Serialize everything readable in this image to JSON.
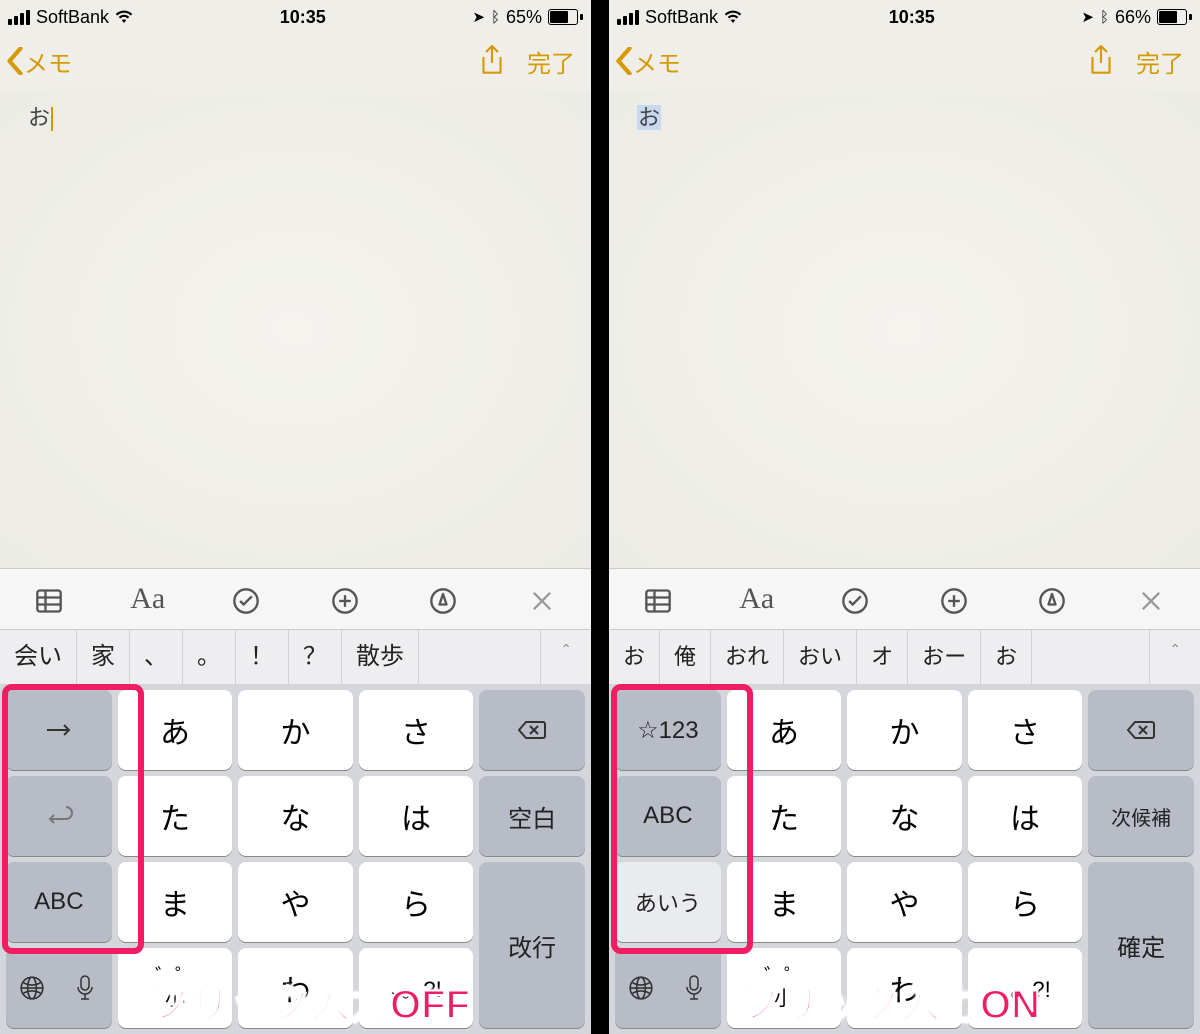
{
  "left": {
    "status": {
      "carrier": "SoftBank",
      "time": "10:35",
      "battery_pct": "65%",
      "battery_fill": 65
    },
    "nav": {
      "back_label": "メモ",
      "done_label": "完了"
    },
    "note_text": "お",
    "note_has_caret": true,
    "note_selected": false,
    "format_icons": [
      "grid-icon",
      "text-style-icon",
      "check-circle-icon",
      "plus-circle-icon",
      "pen-circle-icon",
      "close-icon"
    ],
    "suggestions": [
      "会い",
      "家",
      "、",
      "。",
      "！",
      "？",
      "散歩"
    ],
    "keyboard": {
      "side_keys": [
        "→",
        "↩",
        "ABC"
      ],
      "side_styles": [
        "func",
        "func",
        "func"
      ],
      "main": [
        [
          "あ",
          "か",
          "さ"
        ],
        [
          "た",
          "な",
          "は"
        ],
        [
          "ま",
          "や",
          "ら"
        ],
        [
          "globe-mic",
          "゛小",
          "わ"
        ]
      ],
      "right_keys": [
        "⌫",
        "空白",
        "改行"
      ],
      "last_left": "globe-mic",
      "last_center": [
        "゛゜",
        "わ",
        ".?!"
      ],
      "globe": "globe",
      "mic": "mic",
      "row4_left": "globe-mic",
      "row4_mid1": "゛゜ 小",
      "row4_mid1_sub": "",
      "row4_mid2": "わ",
      "row4_mid3": ".?!"
    },
    "caption": "フリック入力OFF"
  },
  "right": {
    "status": {
      "carrier": "SoftBank",
      "time": "10:35",
      "battery_pct": "66%",
      "battery_fill": 66
    },
    "nav": {
      "back_label": "メモ",
      "done_label": "完了"
    },
    "note_text": "お",
    "note_has_caret": false,
    "note_selected": true,
    "suggestions": [
      "お",
      "俺",
      "おれ",
      "おい",
      "オ",
      "おー",
      "お"
    ],
    "keyboard": {
      "side_keys": [
        "☆123",
        "ABC",
        "あいう"
      ],
      "side_styles": [
        "func",
        "func",
        "func light"
      ],
      "right_keys": [
        "⌫",
        "次候補",
        "確定"
      ],
      "row4_mid1": "゛゜ 小",
      "row4_mid2": "わ",
      "row4_mid3": ".?!"
    },
    "caption": "フリック入力ON"
  },
  "kana_rows": [
    [
      "あ",
      "か",
      "さ"
    ],
    [
      "た",
      "な",
      "は"
    ],
    [
      "ま",
      "や",
      "ら"
    ]
  ],
  "colors": {
    "accent": "#d69a00",
    "highlight": "#ef1e63"
  }
}
